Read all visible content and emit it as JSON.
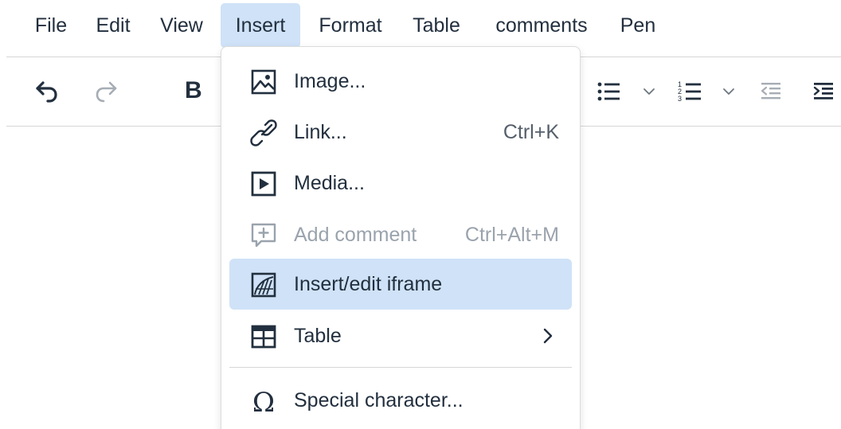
{
  "menubar": {
    "items": [
      {
        "label": "File"
      },
      {
        "label": "Edit"
      },
      {
        "label": "View"
      },
      {
        "label": "Insert",
        "active": true
      },
      {
        "label": "Format"
      },
      {
        "label": "Table"
      },
      {
        "label": "comments"
      },
      {
        "label": "Pen"
      }
    ]
  },
  "toolbar": {
    "undo_icon": "undo-icon",
    "redo_icon": "redo-icon",
    "bold_label": "B",
    "bullet_list_icon": "bullet-list-icon",
    "numbered_list_icon": "numbered-list-icon",
    "outdent_icon": "outdent-icon",
    "indent_icon": "indent-icon"
  },
  "insert_menu": {
    "items": [
      {
        "label": "Image...",
        "icon": "image-icon",
        "shortcut": ""
      },
      {
        "label": "Link...",
        "icon": "link-icon",
        "shortcut": "Ctrl+K"
      },
      {
        "label": "Media...",
        "icon": "media-icon",
        "shortcut": ""
      },
      {
        "label": "Add comment",
        "icon": "add-comment-icon",
        "shortcut": "Ctrl+Alt+M",
        "disabled": true
      },
      {
        "label": "Insert/edit iframe",
        "icon": "iframe-icon",
        "shortcut": "",
        "highlighted": true
      },
      {
        "label": "Table",
        "icon": "table-icon",
        "shortcut": "",
        "submenu": true
      },
      {
        "label": "Special character...",
        "icon": "omega-icon",
        "shortcut": ""
      }
    ]
  },
  "colors": {
    "highlight": "#cfe2f7",
    "text": "#222f3e",
    "disabled_text": "#9aa3ad",
    "divider": "#d6d6d6"
  }
}
